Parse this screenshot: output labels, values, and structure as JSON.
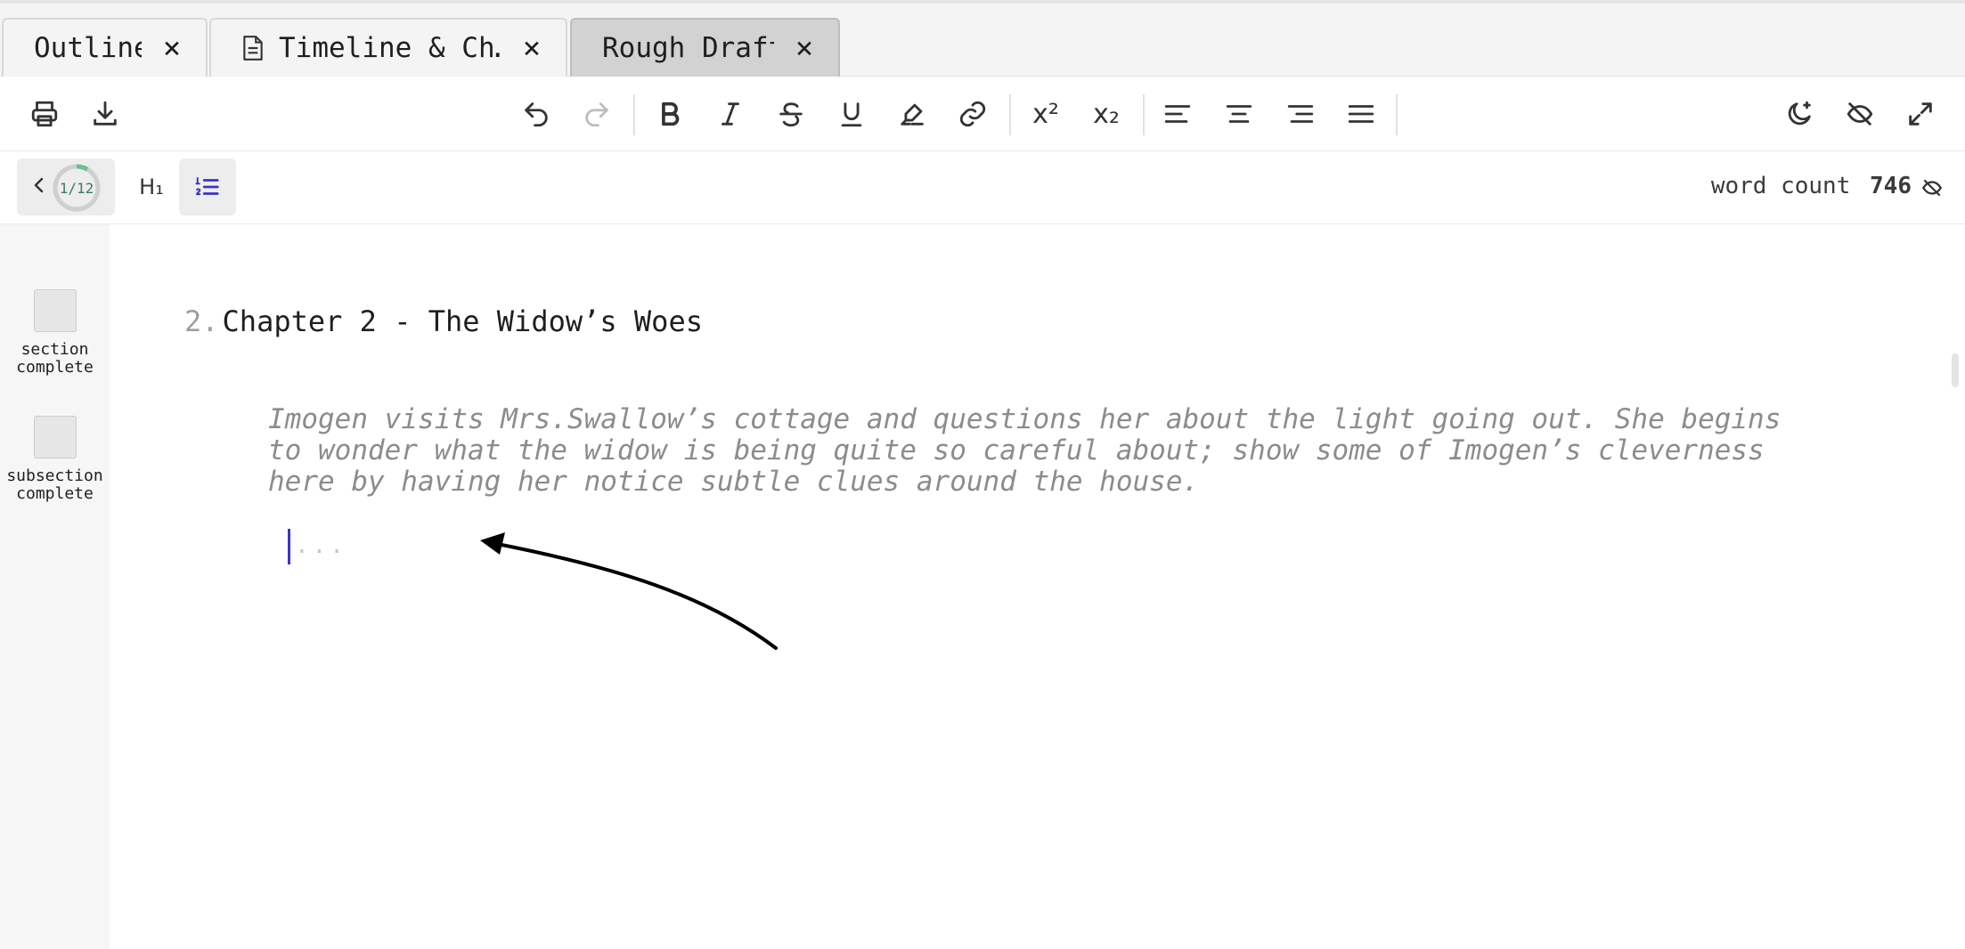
{
  "tabs": [
    {
      "label": "Outline",
      "close": "×",
      "has_doc_icon": false,
      "active": false
    },
    {
      "label": "Timeline & Ch…",
      "close": "×",
      "has_doc_icon": true,
      "active": false
    },
    {
      "label": "Rough Draft",
      "close": "×",
      "has_doc_icon": false,
      "active": true
    }
  ],
  "toolbar": {
    "left_icons": [
      "printer-icon",
      "download-icon"
    ],
    "edit_icons": [
      "undo-icon",
      "redo-icon"
    ],
    "format_icons": [
      "bold-icon",
      "italic-icon",
      "strikethrough-icon",
      "underline-icon",
      "highlighter-icon",
      "link-icon"
    ],
    "script_labels": {
      "superscript": "x²",
      "subscript": "x₂"
    },
    "align_icons": [
      "align-left-icon",
      "align-center-icon",
      "align-right-icon",
      "align-justify-icon"
    ],
    "right_icons": [
      "dark-mode-icon",
      "hide-icon",
      "fullscreen-icon"
    ]
  },
  "subbar": {
    "progress": {
      "label": "1/12",
      "value": 1,
      "total": 12
    },
    "heading_button": "H₁",
    "word_count_label": "word count",
    "word_count_value": "746"
  },
  "gutter": {
    "section_label": "section complete",
    "subsection_label": "subsection complete"
  },
  "editor": {
    "heading_number": "2.",
    "heading_text": "Chapter 2 - The Widow’s Woes",
    "note_text": "Imogen visits Mrs.Swallow’s cottage and questions her about the light going out. She  begins\nto wonder what the widow is being quite so careful about; show some of Imogen’s cleverness\nhere by having her notice subtle clues around the house.",
    "placeholder": "..."
  },
  "colors": {
    "accent": "#3a35c8",
    "progress_green": "#6bbf94",
    "active_tab": "#d2d2d2"
  }
}
